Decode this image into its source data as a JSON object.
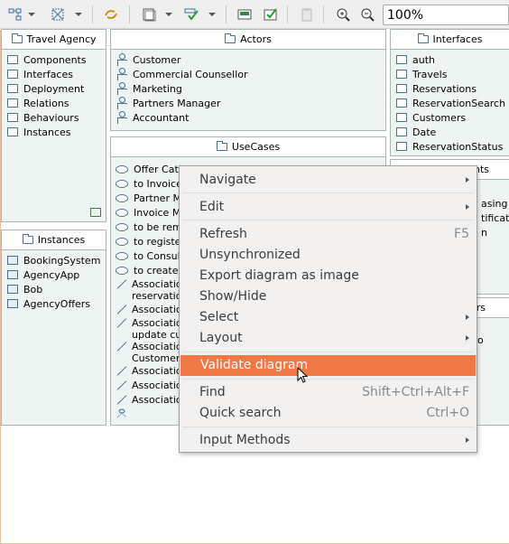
{
  "toolbar": {
    "buttons": [
      "layout-icon",
      "filter-icon",
      "sync-icon",
      "frame-icon",
      "select-icon",
      "image-icon",
      "validate-icon",
      "clipboard-icon",
      "zoom-in-icon",
      "zoom-out-icon"
    ],
    "zoom_value": "100%"
  },
  "travel_agency": {
    "title": "Travel Agency",
    "items": [
      "Components",
      "Interfaces",
      "Deployment",
      "Relations",
      "Behaviours",
      "Instances"
    ]
  },
  "instances": {
    "title": "Instances",
    "items": [
      "BookingSystem",
      "AgencyApp",
      "Bob",
      "AgencyOffers"
    ]
  },
  "actors": {
    "title": "Actors",
    "items": [
      "Customer",
      "Commercial Counsellor",
      "Marketing",
      "Partners Manager",
      "Accountant"
    ]
  },
  "interfaces": {
    "title": "Interfaces",
    "items": [
      "auth",
      "Travels",
      "Reservations",
      "ReservationSearch",
      "Customers",
      "Date",
      "ReservationStatus"
    ]
  },
  "usecases": {
    "title": "UseCases",
    "items": [
      "Offer Catal",
      "to Invoice",
      "Partner Ma",
      "Invoice Ma",
      "to be remin",
      "to register a",
      "to Consult",
      "to create a",
      "Association",
      "reservation",
      "Association",
      "Association",
      "update cust",
      "Association",
      "Customers",
      "Association",
      "Association",
      "Association"
    ]
  },
  "hidden_right": {
    "components_suffix": "nts",
    "lines": [
      "asing",
      "tification",
      "n",
      "rs",
      "o"
    ]
  },
  "context_menu": {
    "items": [
      {
        "label": "Navigate",
        "shortcut": "",
        "submenu": true
      },
      {
        "label": "Edit",
        "shortcut": "",
        "submenu": true
      },
      {
        "label": "Refresh",
        "shortcut": "F5",
        "submenu": false
      },
      {
        "label": "Unsynchronized",
        "shortcut": "",
        "submenu": false
      },
      {
        "label": "Export diagram as image",
        "shortcut": "",
        "submenu": false
      },
      {
        "label": "Show/Hide",
        "shortcut": "",
        "submenu": false
      },
      {
        "label": "Select",
        "shortcut": "",
        "submenu": true
      },
      {
        "label": "Layout",
        "shortcut": "",
        "submenu": true
      },
      {
        "label": "Validate diagram",
        "shortcut": "",
        "submenu": false
      },
      {
        "label": "Find",
        "shortcut": "Shift+Ctrl+Alt+F",
        "submenu": false
      },
      {
        "label": "Quick search",
        "shortcut": "Ctrl+O",
        "submenu": false
      },
      {
        "label": "Input Methods",
        "shortcut": "",
        "submenu": true
      }
    ],
    "highlighted": "Validate diagram"
  },
  "colors": {
    "highlight": "#f07746",
    "panel_bg": "#eef4f1",
    "panel_border": "#a9b7b0",
    "icon_blue": "#4b6f8f"
  }
}
